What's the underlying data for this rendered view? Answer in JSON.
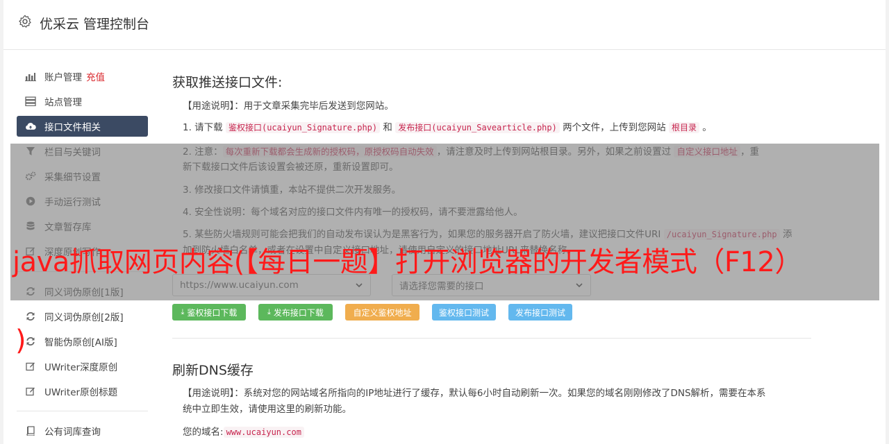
{
  "header": {
    "title": "优采云 管理控制台",
    "icon": "gear-icon"
  },
  "sidebar": {
    "items": [
      {
        "label": "账户管理",
        "extra": "充值",
        "icon": "bar-chart-icon"
      },
      {
        "label": "站点管理",
        "icon": "server-icon"
      },
      {
        "label": "接口文件相关",
        "icon": "cloud-upload-icon",
        "active": true
      },
      {
        "label": "栏目与关键词",
        "icon": "filter-icon"
      },
      {
        "label": "采集细节设置",
        "icon": "cogs-icon"
      },
      {
        "label": "手动运行测试",
        "icon": "play-icon"
      },
      {
        "label": "文章暂存库",
        "icon": "database-icon"
      },
      {
        "label": "深度原创写作",
        "icon": "edit-icon"
      },
      {
        "label": "同义词伪原创[1版]",
        "icon": "refresh-icon"
      },
      {
        "label": "同义词伪原创[2版]",
        "icon": "refresh-icon"
      },
      {
        "label": "智能伪原创[AI版]",
        "icon": "refresh-icon"
      },
      {
        "label": "UWriter深度原创",
        "icon": "edit-icon"
      },
      {
        "label": "UWriter原创标题",
        "icon": "edit-icon"
      },
      {
        "label": "公有词库查询",
        "icon": "book-icon"
      }
    ]
  },
  "section1": {
    "title": "获取推送接口文件:",
    "usage": "【用途说明】：用于文章采集完毕后发送到您网站。",
    "step1": {
      "a": "1. 请下载 ",
      "code1": "鉴权接口(ucaiyun_Signature.php)",
      "b": " 和 ",
      "code2": "发布接口(ucaiyun_Savearticle.php)",
      "c": " 两个文件，上传到您网站 ",
      "code3": "根目录",
      "d": " 。"
    },
    "step2": {
      "a": "2. 注意：",
      "code1": "每次重新下载都会生成新的授权码，原授权码自动失效",
      "b": "，请注意及时上传到网站根目录。另外，如果之前设置过 ",
      "code2": "自定义接口地址",
      "c": "，重",
      "line2": "新下载接口文件后该设置会被还原，重新设置即可。"
    },
    "step3": "3. 修改接口文件请慎重，本站不提供二次开发服务。",
    "step4": "4. 安全性说明：每个域名对应的接口文件内有唯一的授权码，请不要泄露给他人。",
    "step5": {
      "a": "5. 某些防火墙规则可能会把我们的自动发布误认为是黑客行为，如果您的服务器开启了防火墙，建议把接口文件URI ",
      "code1": "/ucaiyun_Signature.php",
      "b": " 添"
    },
    "step5_line2": "加到防火墙白名单，或者在设置中自定义接口地址，请使用自定义的接口地址URL来替换名称。",
    "domain_select": "https://www.ucaiyun.com",
    "interface_select": "请选择您需要的接口",
    "buttons": {
      "download_auth": "鉴权接口下载",
      "download_publish": "发布接口下载",
      "custom_auth": "自定义鉴权地址",
      "test_auth": "鉴权接口测试",
      "test_publish": "发布接口测试"
    }
  },
  "section2": {
    "title": "刷新DNS缓存",
    "usage_line1": "【用途说明】：系统对您的网站域名所指向的IP地址进行了缓存，默认每6小时自动刷新一次。如果您的域名刚刚修改了DNS解析，需要在本系",
    "usage_line2": "统中立即生效，请使用这里的刷新功能。",
    "domain_label": "您的域名:",
    "domain_value": "www.ucaiyun.com"
  },
  "banner": {
    "text": "java抓取网页内容(【每日一题】打开浏览器的开发者模式（F12）",
    "text2": ")"
  },
  "colors": {
    "active_nav": "#3b4a63",
    "recharge": "#d9262b",
    "banner": "#ff1a1a",
    "green_btn": "#5cb85c",
    "orange_btn": "#f0ad4e",
    "blue_btn": "#63b8ee"
  }
}
